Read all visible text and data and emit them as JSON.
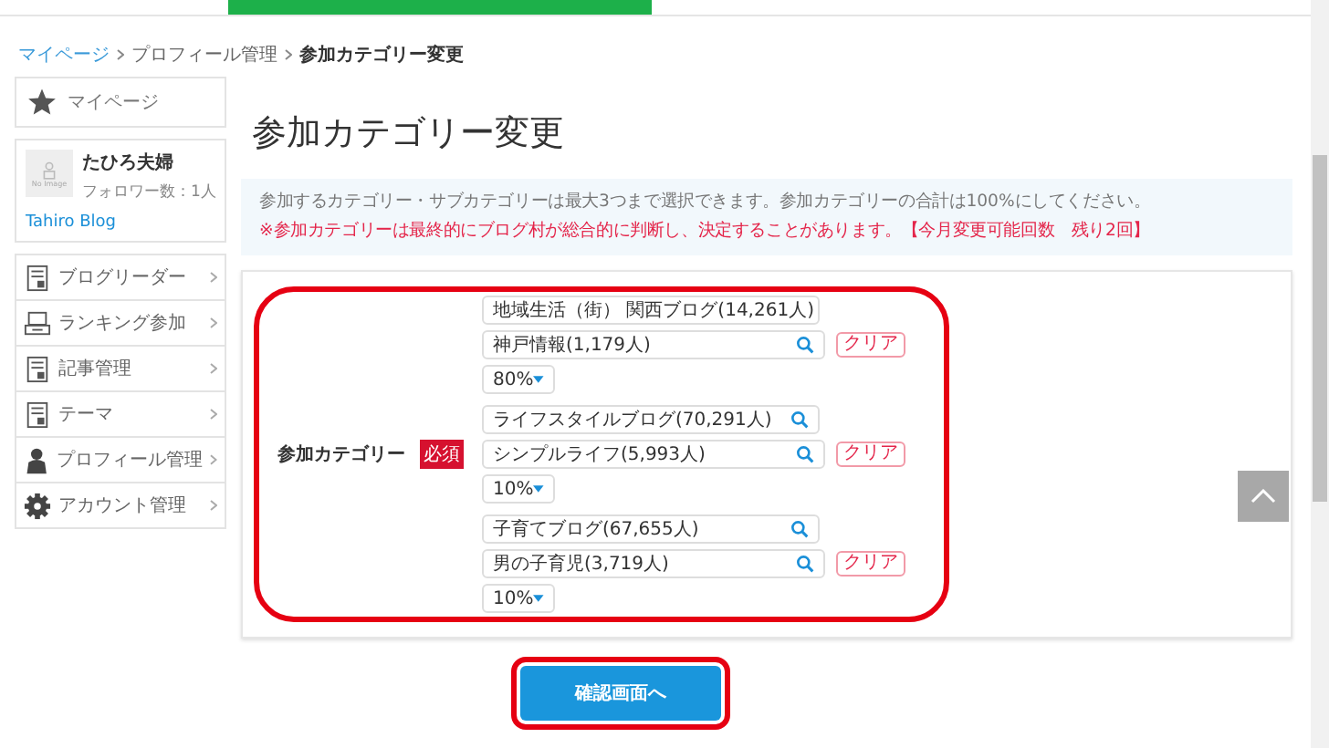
{
  "breadcrumb": {
    "links": [
      "マイページ",
      "プロフィール管理"
    ],
    "current": "参加カテゴリー変更"
  },
  "sidebar": {
    "mypage": "マイページ",
    "profile": {
      "avatar_text": "No Image",
      "name": "たひろ夫婦",
      "followers": "フォロワー数：1人",
      "blog": "Tahiro Blog"
    },
    "menu": [
      {
        "label": "ブログリーダー"
      },
      {
        "label": "ランキング参加"
      },
      {
        "label": "記事管理"
      },
      {
        "label": "テーマ"
      },
      {
        "label": "プロフィール管理"
      },
      {
        "label": "アカウント管理"
      }
    ]
  },
  "title": "参加カテゴリー変更",
  "notice": {
    "text": "参加するカテゴリー・サブカテゴリーは最大3つまで選択できます。参加カテゴリーの合計は100%にしてください。",
    "warning": "※参加カテゴリーは最終的にブログ村が総合的に判断し、決定することがあります。【今月変更可能回数　残り2回】"
  },
  "form": {
    "label": "参加カテゴリー",
    "required_badge": "必須",
    "groups": [
      {
        "category": "地域生活（街） 関西ブログ(14,261人)",
        "subcategory": "神戸情報(1,179人)",
        "clear": "クリア",
        "share": "80%"
      },
      {
        "category": "ライフスタイルブログ(70,291人)",
        "subcategory": "シンプルライフ(5,993人)",
        "clear": "クリア",
        "share": "10%"
      },
      {
        "category": "子育てブログ(67,655人)",
        "subcategory": "男の子育児(3,719人)",
        "clear": "クリア",
        "share": "10%"
      }
    ]
  },
  "confirm_button": "確認画面へ"
}
